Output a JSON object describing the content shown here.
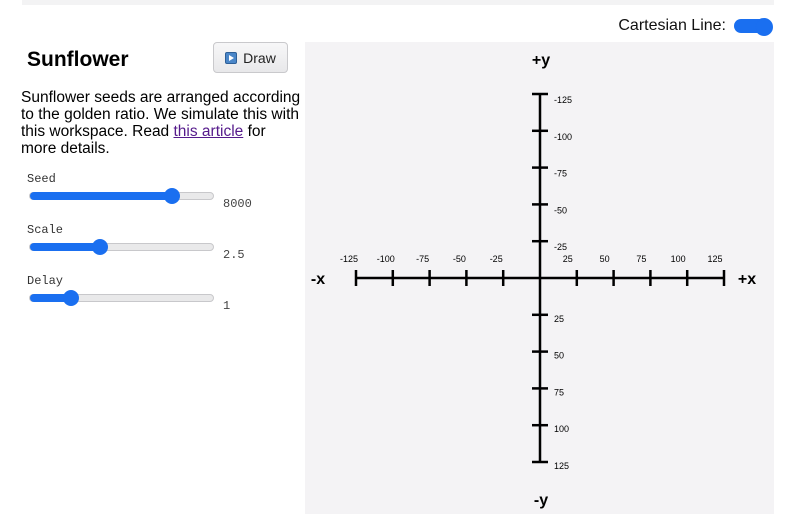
{
  "header": {
    "cartesian_label": "Cartesian Line:",
    "cartesian_on": true
  },
  "panel": {
    "title": "Sunflower",
    "draw_label": "Draw",
    "desc_before": "Sunflower seeds are arranged according to the golden ratio. We simulate this with this workspace. Read ",
    "desc_link": "this article",
    "desc_after": " for more details."
  },
  "sliders": [
    {
      "label": "Seed",
      "value": "8000",
      "fraction": 0.77
    },
    {
      "label": "Scale",
      "value": "2.5",
      "fraction": 0.38
    },
    {
      "label": "Delay",
      "value": "1",
      "fraction": 0.22
    }
  ],
  "axes": {
    "plus_y": "+y",
    "minus_y": "-y",
    "plus_x": "+x",
    "minus_x": "-x",
    "x_ticks": [
      -125,
      -100,
      -75,
      -50,
      -25,
      25,
      50,
      75,
      100,
      125
    ],
    "y_ticks": [
      -125,
      -100,
      -75,
      -50,
      -25,
      25,
      50,
      75,
      100,
      125
    ],
    "color": "#000000"
  },
  "colors": {
    "accent": "#1a6ff0",
    "canvas_bg": "#f4f3f5",
    "link": "#551a8b"
  },
  "icons": {
    "draw": "play-icon"
  }
}
